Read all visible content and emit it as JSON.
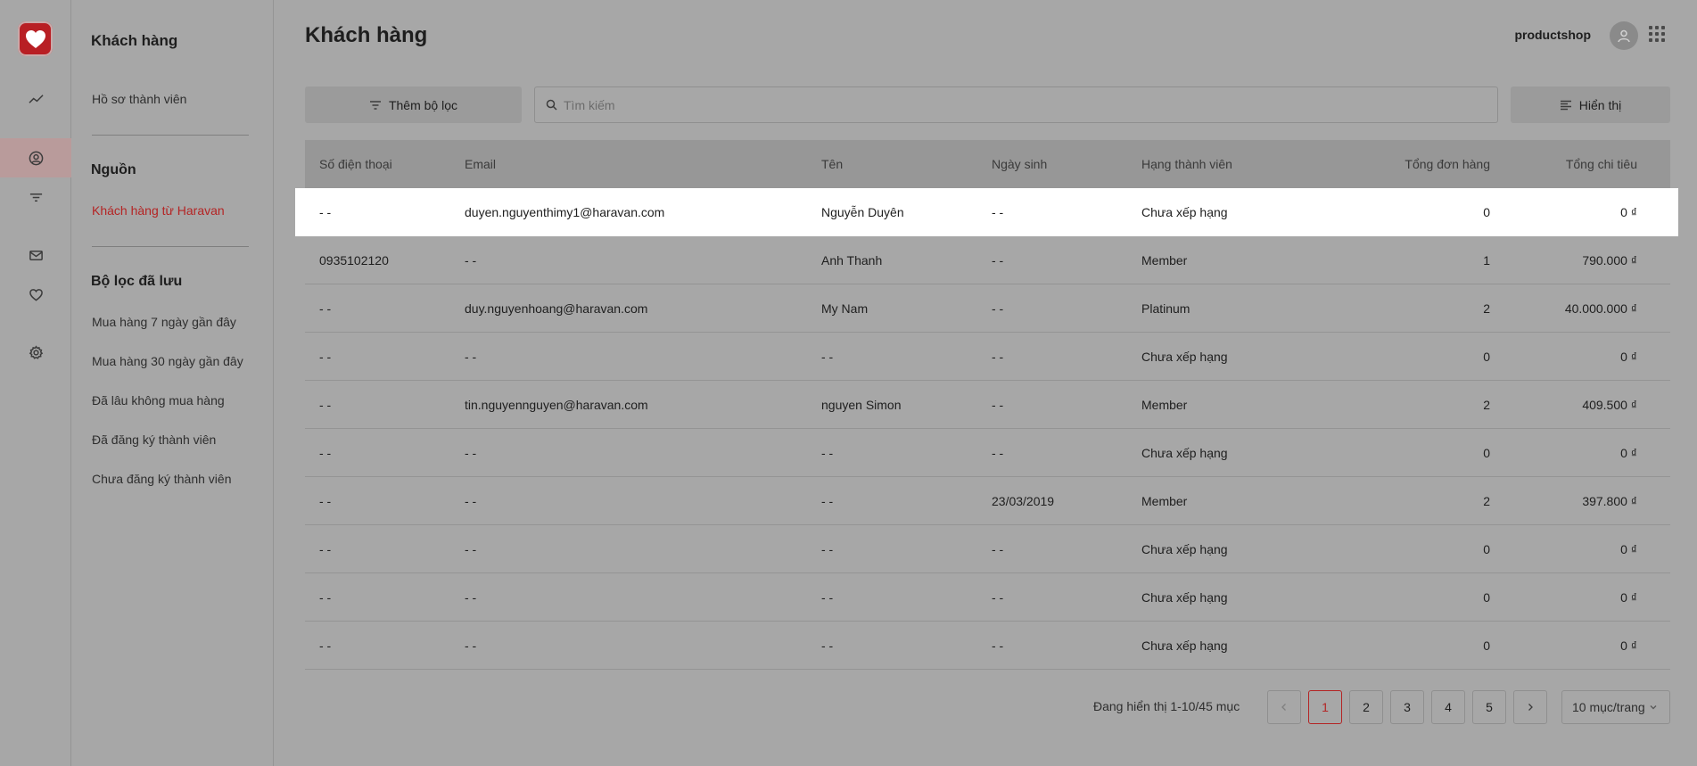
{
  "rail": {
    "items": [
      {
        "icon": "analytics-icon"
      },
      {
        "icon": "customer-icon"
      },
      {
        "icon": "filter-icon"
      },
      {
        "icon": "mail-icon"
      },
      {
        "icon": "loyalty-heart-icon"
      },
      {
        "icon": "settings-gear-icon"
      }
    ]
  },
  "sidebar": {
    "title": "Khách hàng",
    "member_profile": "Hồ sơ thành viên",
    "source_heading": "Nguồn",
    "source_haravan": "Khách hàng từ Haravan",
    "saved_filters_heading": "Bộ lọc đã lưu",
    "saved_filters": [
      "Mua hàng 7 ngày gần đây",
      "Mua hàng 30 ngày gần đây",
      "Đã lâu không mua hàng",
      "Đã đăng ký thành viên",
      "Chưa đăng ký thành viên"
    ]
  },
  "header": {
    "title": "Khách hàng",
    "shop": "productshop"
  },
  "toolbar": {
    "add_filter": "Thêm bộ lọc",
    "search_placeholder": "Tìm kiếm",
    "display": "Hiển thị"
  },
  "table": {
    "columns": [
      "Số điện thoại",
      "Email",
      "Tên",
      "Ngày sinh",
      "Hạng thành viên",
      "Tổng đơn hàng",
      "Tổng chi tiêu"
    ],
    "rows": [
      [
        "- -",
        "duyen.nguyenthimy1@haravan.com",
        "Nguyễn Duyên",
        "- -",
        "Chưa xếp hạng",
        "0",
        "0 ₫"
      ],
      [
        "0935102120",
        "- -",
        "Anh Thanh",
        "- -",
        "Member",
        "1",
        "790.000 ₫"
      ],
      [
        "- -",
        "duy.nguyenhoang@haravan.com",
        "My Nam",
        "- -",
        "Platinum",
        "2",
        "40.000.000 ₫"
      ],
      [
        "- -",
        "- -",
        "- -",
        "- -",
        "Chưa xếp hạng",
        "0",
        "0 ₫"
      ],
      [
        "- -",
        "tin.nguyennguyen@haravan.com",
        "nguyen Simon",
        "- -",
        "Member",
        "2",
        "409.500 ₫"
      ],
      [
        "- -",
        "- -",
        "- -",
        "- -",
        "Chưa xếp hạng",
        "0",
        "0 ₫"
      ],
      [
        "- -",
        "- -",
        "- -",
        "23/03/2019",
        "Member",
        "2",
        "397.800 ₫"
      ],
      [
        "- -",
        "- -",
        "- -",
        "- -",
        "Chưa xếp hạng",
        "0",
        "0 ₫"
      ],
      [
        "- -",
        "- -",
        "- -",
        "- -",
        "Chưa xếp hạng",
        "0",
        "0 ₫"
      ],
      [
        "- -",
        "- -",
        "- -",
        "- -",
        "Chưa xếp hạng",
        "0",
        "0 ₫"
      ]
    ]
  },
  "pagination": {
    "info": "Đang hiển thị 1-10/45 mục",
    "pages": [
      "1",
      "2",
      "3",
      "4",
      "5"
    ],
    "current": "1",
    "per_page": "10 mục/trang"
  },
  "colors": {
    "accent": "#b42424",
    "background_dimmed": "#a7a7a7",
    "highlight_row": "#ffffff"
  }
}
